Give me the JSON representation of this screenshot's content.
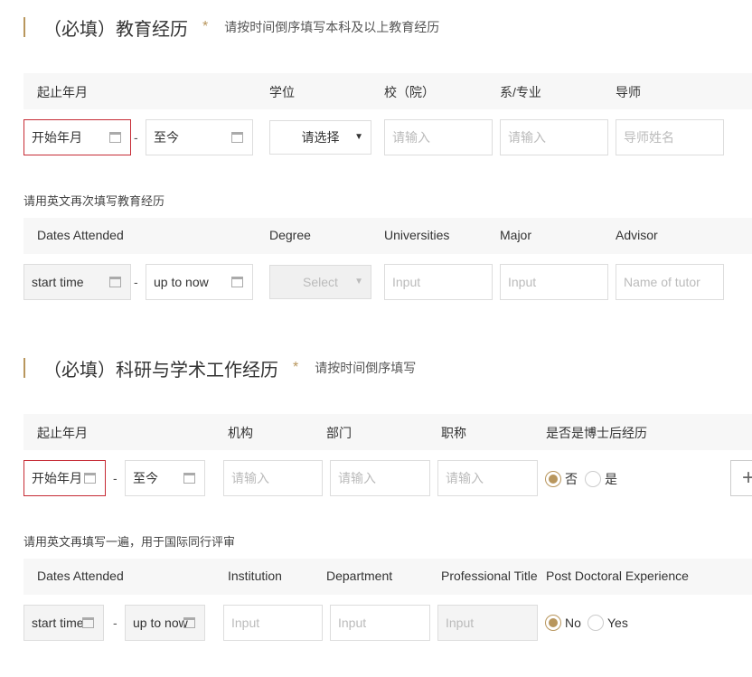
{
  "education": {
    "title": "（必填）教育经历",
    "required_mark": "*",
    "hint": "请按时间倒序填写本科及以上教育经历",
    "headers": [
      "起止年月",
      "学位",
      "校（院）",
      "系/专业",
      "导师"
    ],
    "start_date": "开始年月",
    "date_separator": "-",
    "end_date": "至今",
    "degree_select": "请选择",
    "school_placeholder": "请输入",
    "major_placeholder": "请输入",
    "advisor_placeholder": "导师姓名",
    "english_subtitle": "请用英文再次填写教育经历",
    "en_headers": [
      "Dates Attended",
      "Degree",
      "Universities",
      "Major",
      "Advisor"
    ],
    "en_start_date": "start time",
    "en_end_date": "up to now",
    "en_degree_select": "Select",
    "en_school_placeholder": "Input",
    "en_major_placeholder": "Input",
    "en_advisor_placeholder": "Name of tutor"
  },
  "research": {
    "title": "（必填）科研与学术工作经历",
    "required_mark": "*",
    "hint": "请按时间倒序填写",
    "headers": [
      "起止年月",
      "机构",
      "部门",
      "职称",
      "是否是博士后经历"
    ],
    "start_date": "开始年月",
    "date_separator": "-",
    "end_date": "至今",
    "institution_placeholder": "请输入",
    "department_placeholder": "请输入",
    "title_placeholder": "请输入",
    "postdoc_no": "否",
    "postdoc_yes": "是",
    "add_button": "+",
    "english_subtitle": "请用英文再填写一遍，用于国际同行评审",
    "en_headers": [
      "Dates Attended",
      "Institution",
      "Department",
      "Professional Title",
      "Post Doctoral Experience"
    ],
    "en_start_date": "start time",
    "en_end_date": "up to now",
    "en_institution_placeholder": "Input",
    "en_department_placeholder": "Input",
    "en_title_placeholder": "Input",
    "en_postdoc_no": "No",
    "en_postdoc_yes": "Yes"
  },
  "colors": {
    "accent": "#b8965d",
    "error_border": "#c62b35",
    "header_bg": "#f7f7f7"
  },
  "icons": [
    "calendar-icon",
    "caret-down-icon",
    "plus-icon"
  ]
}
